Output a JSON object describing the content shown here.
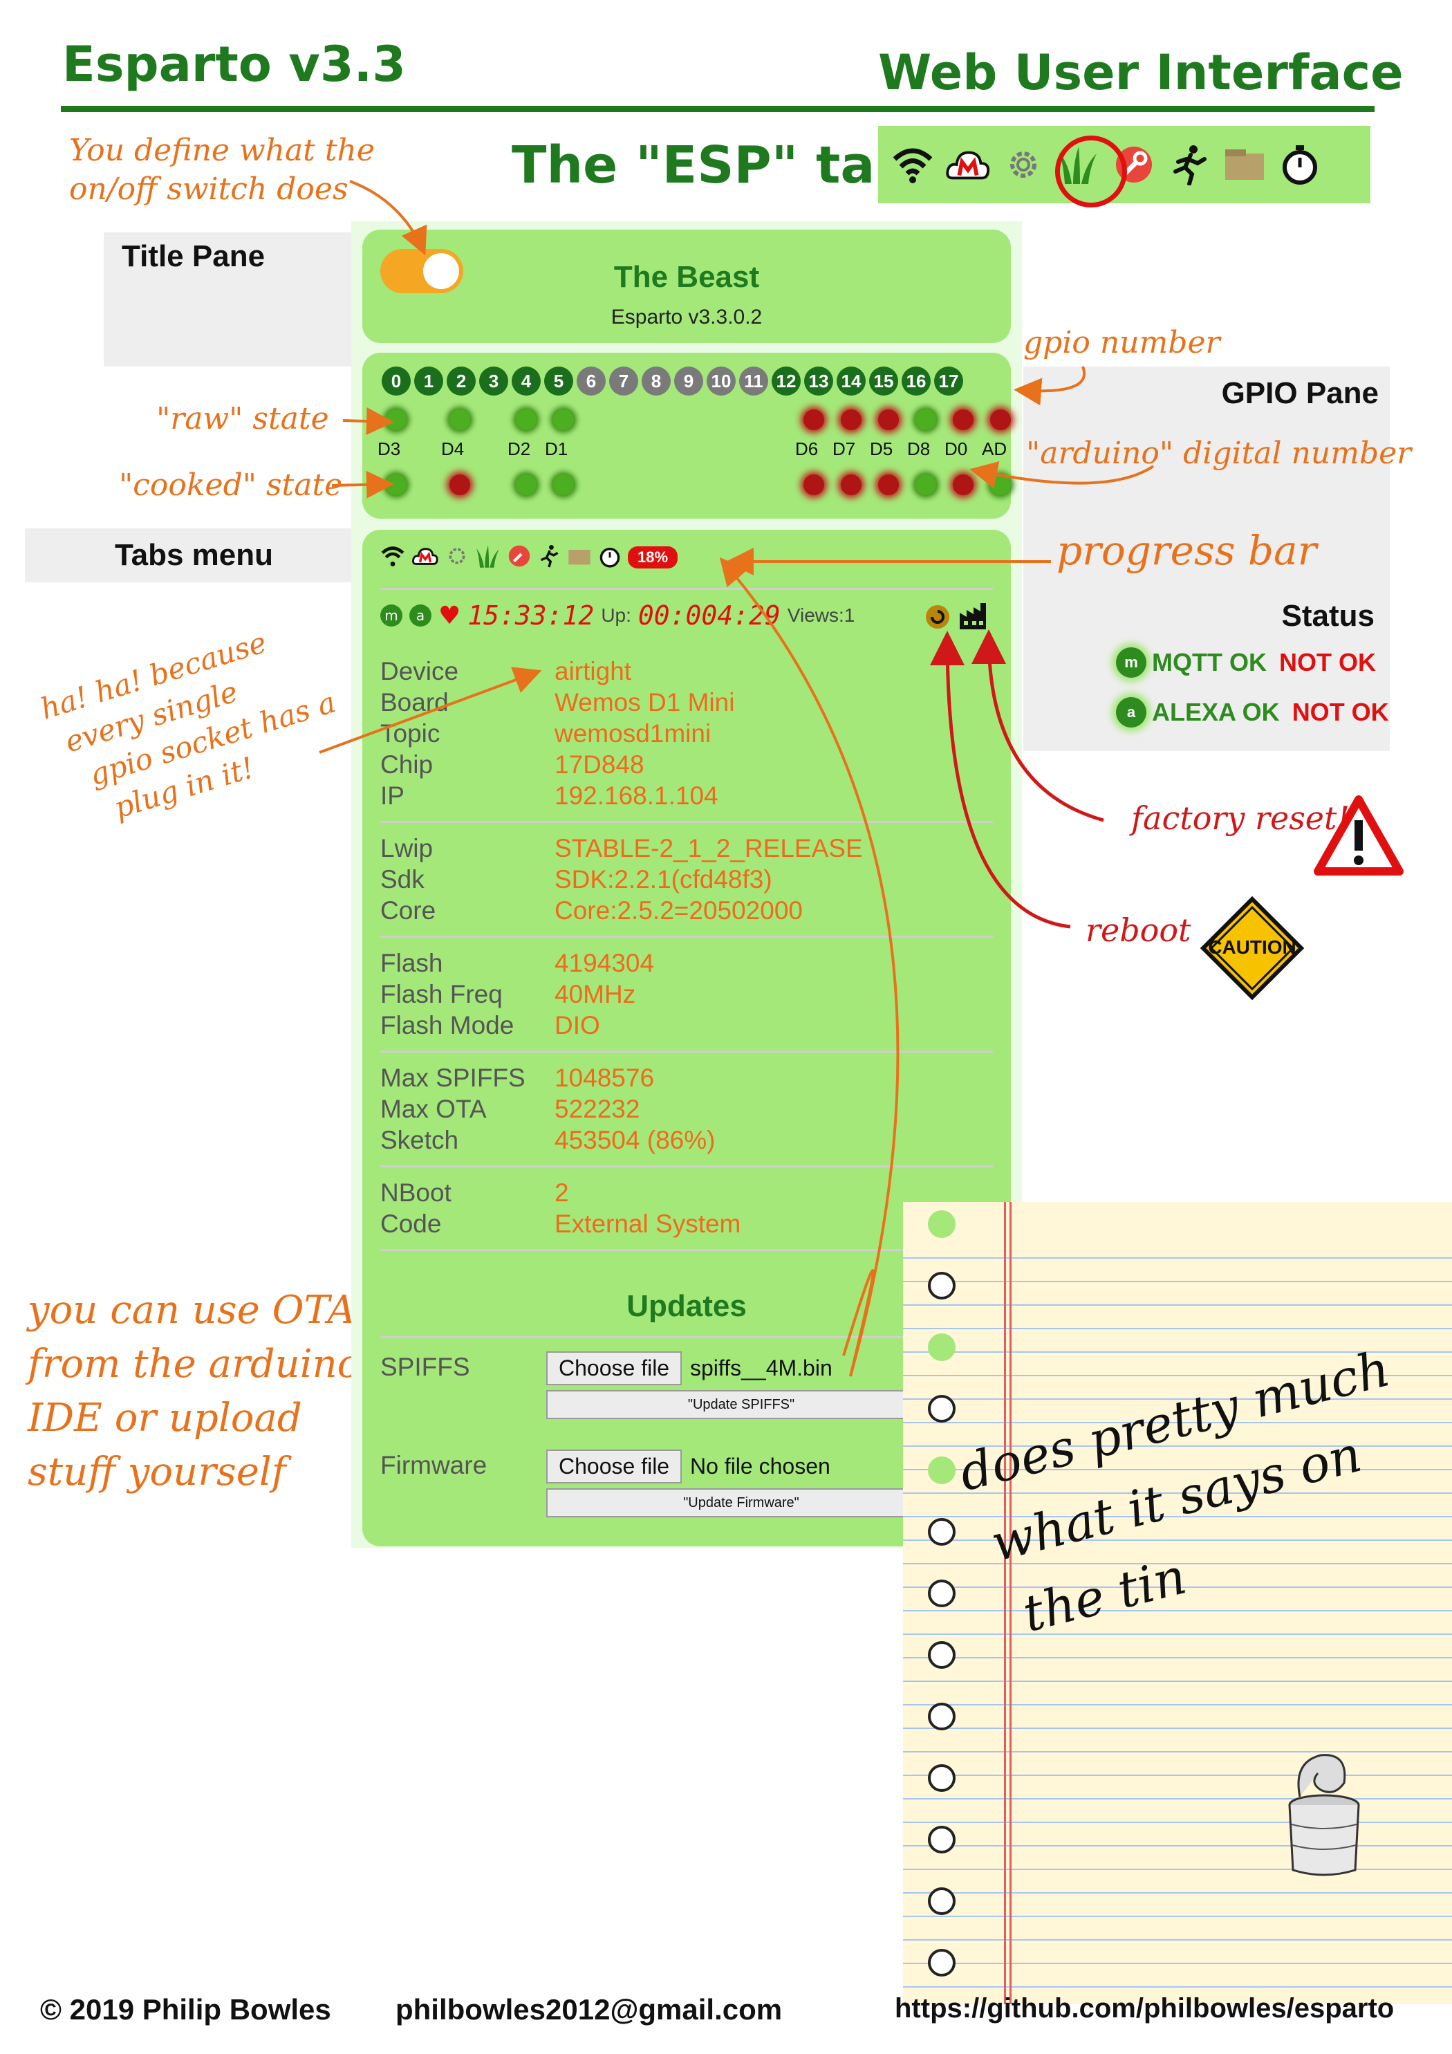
{
  "header": {
    "title_left": "Esparto v3.3",
    "title_right": "Web User Interface",
    "esp_tab_title": "The \"ESP\" tab"
  },
  "tab_icons": [
    "wifi-icon",
    "mqtt-cloud-icon",
    "gear-icon",
    "grass-icon",
    "wrench-icon",
    "runner-icon",
    "package-icon",
    "stopwatch-icon"
  ],
  "section_labels": {
    "title_pane": "Title Pane",
    "gpio_pane": "GPIO Pane",
    "tabs_menu": "Tabs menu",
    "status": "Status"
  },
  "title_pane": {
    "device_name": "The Beast",
    "version": "Esparto v3.3.0.2",
    "switch_on": true
  },
  "gpio": {
    "numbers": [
      "0",
      "1",
      "2",
      "3",
      "4",
      "5",
      "6",
      "7",
      "8",
      "9",
      "10",
      "11",
      "12",
      "13",
      "14",
      "15",
      "16",
      "17"
    ],
    "number_colors": [
      "#1b6e1b",
      "#1b6e1b",
      "#1b6e1b",
      "#1b6e1b",
      "#1b6e1b",
      "#1b6e1b",
      "#7a7a7a",
      "#7a7a7a",
      "#7a7a7a",
      "#7a7a7a",
      "#7a7a7a",
      "#7a7a7a",
      "#1b6e1b",
      "#1b6e1b",
      "#1b6e1b",
      "#1b6e1b",
      "#1b6e1b",
      "#1b6e1b"
    ],
    "pins": [
      {
        "label": "D3",
        "raw": "g",
        "cooked": "g"
      },
      {
        "label": "D4",
        "raw": "g",
        "cooked": "r"
      },
      {
        "label": "D2",
        "raw": "g",
        "cooked": "g"
      },
      {
        "label": "D1",
        "raw": "g",
        "cooked": "g"
      },
      {
        "label": "D6",
        "raw": "r",
        "cooked": "r"
      },
      {
        "label": "D7",
        "raw": "r",
        "cooked": "r"
      },
      {
        "label": "D5",
        "raw": "r",
        "cooked": "r"
      },
      {
        "label": "D8",
        "raw": "g",
        "cooked": "g"
      },
      {
        "label": "D0",
        "raw": "r",
        "cooked": "r"
      },
      {
        "label": "AD",
        "raw": "r",
        "cooked": "g"
      }
    ]
  },
  "tabs_menu": {
    "progress": "18%"
  },
  "status_line": {
    "m_badge": "m",
    "a_badge": "a",
    "clock": "15:33:12",
    "uptime_label": "Up:",
    "uptime": "00:004:29",
    "views": "Views:1"
  },
  "info_groups": [
    [
      [
        "Device",
        "airtight"
      ],
      [
        "Board",
        "Wemos D1 Mini"
      ],
      [
        "Topic",
        "wemosd1mini"
      ],
      [
        "Chip",
        "17D848"
      ],
      [
        "IP",
        "192.168.1.104"
      ]
    ],
    [
      [
        "Lwip",
        "STABLE-2_1_2_RELEASE"
      ],
      [
        "Sdk",
        "SDK:2.2.1(cfd48f3)"
      ],
      [
        "Core",
        "Core:2.5.2=20502000"
      ]
    ],
    [
      [
        "Flash",
        "4194304"
      ],
      [
        "Flash Freq",
        "40MHz"
      ],
      [
        "Flash Mode",
        "DIO"
      ]
    ],
    [
      [
        "Max SPIFFS",
        "1048576"
      ],
      [
        "Max OTA",
        "522232"
      ],
      [
        "Sketch",
        "453504 (86%)"
      ]
    ],
    [
      [
        "NBoot",
        "2"
      ],
      [
        "Code",
        "External System"
      ]
    ]
  ],
  "updates": {
    "title": "Updates",
    "spiffs_label": "SPIFFS",
    "spiffs_choose": "Choose file",
    "spiffs_file": "spiffs__4M.bin",
    "spiffs_button": "\"Update SPIFFS\"",
    "firmware_label": "Firmware",
    "firmware_choose": "Choose file",
    "firmware_file": "No file chosen",
    "firmware_button": "\"Update Firmware\""
  },
  "status_box": {
    "mqtt_badge": "m",
    "mqtt_label": "MQTT OK",
    "mqtt_bad": "NOT OK",
    "alexa_badge": "a",
    "alexa_label": "ALEXA OK",
    "alexa_bad": "NOT OK"
  },
  "annotations": {
    "switch_note_1": "You define what the",
    "switch_note_2": "on/off switch does",
    "gpio_number": "gpio number",
    "raw_state": "\"raw\" state",
    "cooked_state": "\"cooked\" state",
    "arduino_number": "\"arduino\" digital number",
    "progress_bar": "progress bar",
    "factory_reset": "factory reset!",
    "reboot": "reboot",
    "caution": "CAUTION",
    "haha_1": "ha! ha! because",
    "haha_2": "every single",
    "haha_3": "gpio socket has a",
    "haha_4": "plug in it!",
    "ota_1": "you can use OTA",
    "ota_2": "from the arduino",
    "ota_3": "IDE or upload",
    "ota_4": "stuff yourself",
    "tin_1": "does pretty much",
    "tin_2": "what it says on",
    "tin_3": "the tin"
  },
  "footer": {
    "copyright": "© 2019 Philip Bowles",
    "email": "philbowles2012@gmail.com",
    "url": "https://github.com/philbowles/esparto"
  },
  "colors": {
    "brand_green": "#1f7a1f",
    "pane_green": "#a4e87a",
    "note_orange": "#e8721c",
    "alert_red": "#e01010"
  }
}
